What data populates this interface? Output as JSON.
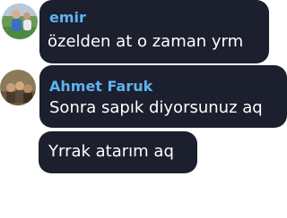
{
  "messages": [
    {
      "author": "emir",
      "text": "özelden at o zaman yrm",
      "avatar": "user-avatar-emir"
    },
    {
      "author": "Ahmet Faruk",
      "text": "Sonra sapık diyorsunuz aq",
      "avatar": "user-avatar-ahmet-faruk"
    },
    {
      "text": "Yrrak atarım aq"
    }
  ],
  "colors": {
    "bubble": "#1c1f2e",
    "name": "#5fb3ef",
    "text": "#ffffff",
    "background": "#ffffff"
  }
}
